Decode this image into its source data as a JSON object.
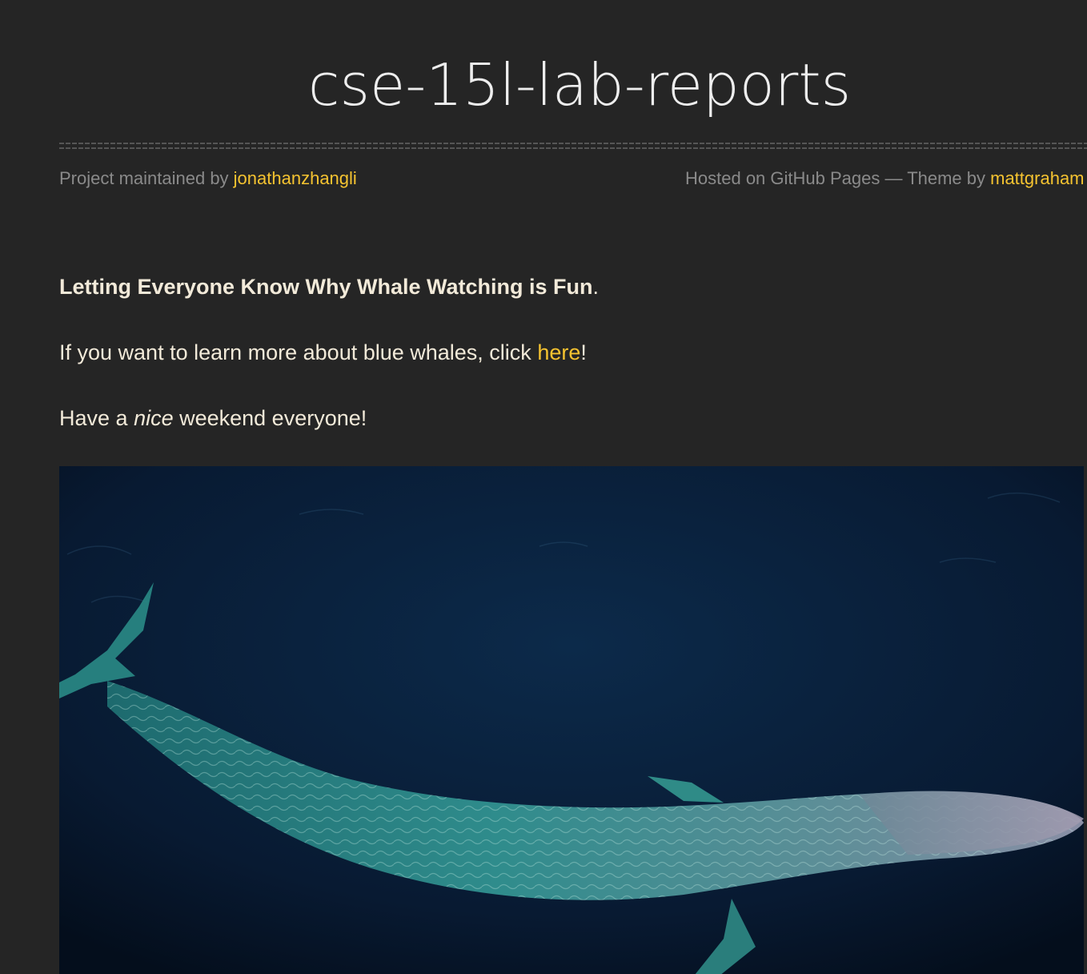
{
  "header": {
    "title": "cse-15l-lab-reports"
  },
  "meta": {
    "maintained_prefix": "Project maintained by ",
    "maintainer": "jonathanzhangli",
    "hosted_text": "Hosted on GitHub Pages — Theme by ",
    "theme_author": "mattgraham"
  },
  "content": {
    "heading_bold": "Letting Everyone Know Why Whale Watching is Fun",
    "heading_period": ".",
    "learn_prefix": "If you want to learn more about blue whales, click ",
    "learn_link": "here",
    "learn_suffix": "!",
    "weekend_prefix": "Have a ",
    "weekend_emphasis": "nice",
    "weekend_suffix": " weekend everyone!"
  },
  "image": {
    "subject": "blue whale swimming in dark ocean water"
  },
  "colors": {
    "background": "#252525",
    "link": "#f5c330",
    "text": "#f2ead9",
    "muted": "#8a8a8a"
  }
}
